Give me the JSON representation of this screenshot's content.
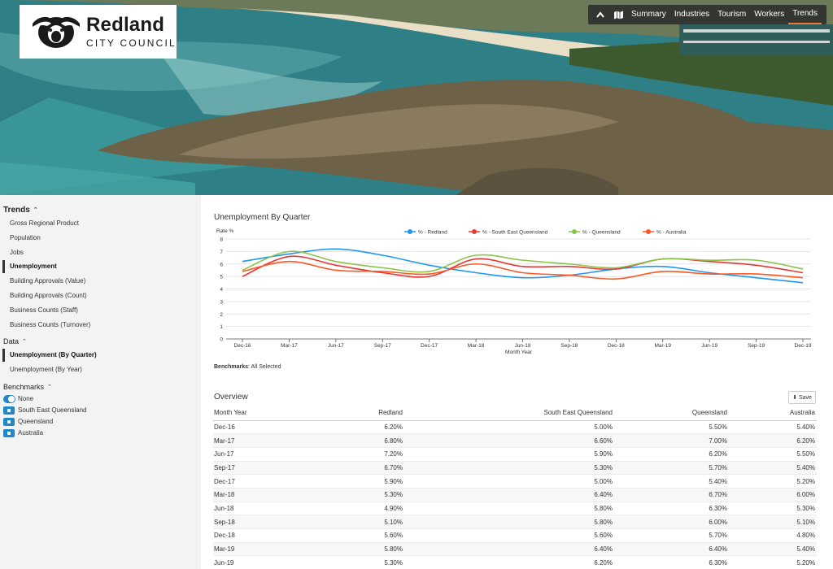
{
  "brand": {
    "name": "Redland",
    "sub": "CITY COUNCIL"
  },
  "topnav": {
    "items": [
      "Summary",
      "Industries",
      "Tourism",
      "Workers",
      "Trends"
    ],
    "active": "Trends"
  },
  "sidebar": {
    "trends_heading": "Trends",
    "trends_items": [
      "Gross Regional Product",
      "Population",
      "Jobs",
      "Unemployment",
      "Building Approvals (Value)",
      "Building Approvals (Count)",
      "Business Counts (Staff)",
      "Business Counts (Turnover)"
    ],
    "data_heading": "Data",
    "data_items": [
      "Unemployment (By Quarter)",
      "Unemployment (By Year)"
    ],
    "benchmarks_heading": "Benchmarks",
    "benchmark_items": [
      "None",
      "South East Queensland",
      "Queensland",
      "Australia"
    ]
  },
  "chart": {
    "title": "Unemployment By Quarter",
    "benchmarks_label": "Benchmarks",
    "benchmarks_value": ": All Selected"
  },
  "overview": {
    "title": "Overview",
    "save_label": "Save",
    "columns": [
      "Month Year",
      "Redland",
      "South East Queensland",
      "Queensland",
      "Australia"
    ],
    "rows": [
      [
        "Dec-16",
        "6.20%",
        "5.00%",
        "5.50%",
        "5.40%"
      ],
      [
        "Mar-17",
        "6.80%",
        "6.60%",
        "7.00%",
        "6.20%"
      ],
      [
        "Jun-17",
        "7.20%",
        "5.90%",
        "6.20%",
        "5.50%"
      ],
      [
        "Sep-17",
        "6.70%",
        "5.30%",
        "5.70%",
        "5.40%"
      ],
      [
        "Dec-17",
        "5.90%",
        "5.00%",
        "5.40%",
        "5.20%"
      ],
      [
        "Mar-18",
        "5.30%",
        "6.40%",
        "6.70%",
        "6.00%"
      ],
      [
        "Jun-18",
        "4.90%",
        "5.80%",
        "6.30%",
        "5.30%"
      ],
      [
        "Sep-18",
        "5.10%",
        "5.80%",
        "6.00%",
        "5.10%"
      ],
      [
        "Dec-18",
        "5.60%",
        "5.60%",
        "5.70%",
        "4.80%"
      ],
      [
        "Mar-19",
        "5.80%",
        "6.40%",
        "6.40%",
        "5.40%"
      ],
      [
        "Jun-19",
        "5.30%",
        "6.20%",
        "6.30%",
        "5.20%"
      ]
    ]
  },
  "chart_data": {
    "type": "line",
    "title": "Unemployment By Quarter",
    "xlabel": "Month Year",
    "ylabel": "Rate %",
    "ylim": [
      0,
      8
    ],
    "yticks": [
      0,
      1,
      2,
      3,
      4,
      5,
      6,
      7,
      8
    ],
    "grid": true,
    "legend": "top",
    "categories": [
      "Dec-16",
      "Mar-17",
      "Jun-17",
      "Sep-17",
      "Dec-17",
      "Mar-18",
      "Jun-18",
      "Sep-18",
      "Dec-18",
      "Mar-19",
      "Jun-19",
      "Sep-19",
      "Dec-19"
    ],
    "series": [
      {
        "name": "% - Redland",
        "color": "#2196f3",
        "values": [
          6.2,
          6.8,
          7.2,
          6.7,
          5.9,
          5.3,
          4.9,
          5.1,
          5.6,
          5.8,
          5.3,
          4.9,
          4.5
        ]
      },
      {
        "name": "% - South East Queensland",
        "color": "#e53935",
        "values": [
          5.0,
          6.6,
          5.9,
          5.3,
          5.0,
          6.4,
          5.8,
          5.8,
          5.6,
          6.4,
          6.2,
          5.9,
          5.3
        ]
      },
      {
        "name": "% - Queensland",
        "color": "#8bc34a",
        "values": [
          5.5,
          7.0,
          6.2,
          5.7,
          5.4,
          6.7,
          6.3,
          6.0,
          5.7,
          6.4,
          6.3,
          6.3,
          5.6
        ]
      },
      {
        "name": "% - Australia",
        "color": "#ff5722",
        "values": [
          5.4,
          6.2,
          5.5,
          5.4,
          5.2,
          6.0,
          5.3,
          5.1,
          4.8,
          5.4,
          5.2,
          5.2,
          4.9
        ]
      }
    ]
  }
}
